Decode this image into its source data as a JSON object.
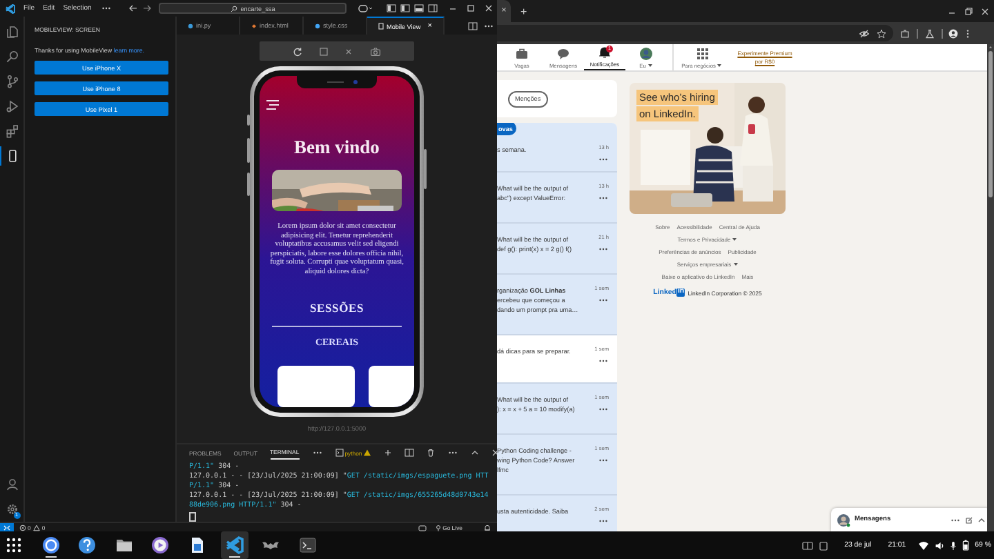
{
  "vscode": {
    "menu": [
      "File",
      "Edit",
      "Selection"
    ],
    "search": "encarte_ssa",
    "activity_bar": [
      {
        "kind": "explorer",
        "selected": false
      },
      {
        "kind": "search",
        "selected": false
      },
      {
        "kind": "source-control",
        "selected": false
      },
      {
        "kind": "run",
        "selected": false
      },
      {
        "kind": "extensions",
        "selected": false
      },
      {
        "kind": "mobile",
        "selected": true
      }
    ],
    "manage_badge": "1",
    "sidebar": {
      "title": "MOBILEVIEW: SCREEN",
      "message": "Thanks for using MobileView",
      "link": "learn more.",
      "buttons": [
        "Use iPhone X",
        "Use iPhone 8",
        "Use Pixel 1"
      ]
    },
    "tabs": [
      {
        "label": "ini.py",
        "kind": "python",
        "selected": false
      },
      {
        "label": "index.html",
        "kind": "html",
        "selected": false
      },
      {
        "label": "style.css",
        "kind": "css",
        "selected": false
      },
      {
        "label": "Mobile View",
        "kind": "preview",
        "selected": true,
        "close": "×"
      }
    ],
    "preview": {
      "page": {
        "heading": "Bem vindo",
        "paragraph": "Lorem ipsum dolor sit amet consectetur adipisicing elit. Tenetur reprehenderit voluptatibus accusamus velit sed eligendi perspiciatis, labore esse dolores officia nihil, fugit soluta. Corrupti quae voluptatum quasi, aliquid dolores dicta?",
        "section_title": "SESSÕES",
        "category": "CEREAIS"
      },
      "url": "http://127.0.0.1:5000"
    },
    "panel": {
      "tabs": [
        {
          "label": "PROBLEMS",
          "selected": false
        },
        {
          "label": "OUTPUT",
          "selected": false
        },
        {
          "label": "TERMINAL",
          "selected": true
        }
      ],
      "shell": "python",
      "lines": [
        [
          {
            "text": "P/1.1\"",
            "kind": "request"
          },
          {
            "text": " 304 -",
            "kind": "plain"
          }
        ],
        [
          {
            "text": "127.0.0.1 - - [23/Jul/2025 21:00:09] \"",
            "kind": "plain"
          },
          {
            "text": "GET /static/imgs/espaguete.png HTT",
            "kind": "request"
          }
        ],
        [
          {
            "text": "P/1.1\"",
            "kind": "request"
          },
          {
            "text": " 304 -",
            "kind": "plain"
          }
        ],
        [
          {
            "text": "127.0.0.1 - - [23/Jul/2025 21:00:09] \"",
            "kind": "plain"
          },
          {
            "text": "GET /static/imgs/655265d48d0743e14",
            "kind": "request"
          }
        ],
        [
          {
            "text": "88de906.png HTTP/1.1\"",
            "kind": "request"
          },
          {
            "text": " 304 -",
            "kind": "plain"
          }
        ]
      ]
    },
    "status_bar": {
      "errors": "0",
      "warnings": "0",
      "go_live": "Go Live"
    }
  },
  "browser": {
    "tab_close": "×",
    "new_tab": "+",
    "nav": [
      {
        "label": "Vagas",
        "kind": "jobs",
        "selected": false,
        "dropdown": false
      },
      {
        "label": "Mensagens",
        "kind": "messages",
        "selected": false,
        "dropdown": false
      },
      {
        "label": "Notificações",
        "kind": "notifications",
        "selected": true,
        "dropdown": false,
        "badge": "1"
      },
      {
        "label": "Eu",
        "kind": "me",
        "selected": false,
        "dropdown": true
      },
      {
        "label": "Para negócios",
        "kind": "business",
        "selected": false,
        "dropdown": true
      }
    ],
    "premium": "Experimente Premium por R$0",
    "filters": [
      "Menções"
    ],
    "new_button": "ovas",
    "notifications": [
      {
        "lines": [
          "s semana."
        ],
        "time": "13 h",
        "unread": true
      },
      {
        "lines": [
          "What will be the output of",
          "abc\") except ValueError:"
        ],
        "time": "13 h",
        "unread": true
      },
      {
        "lines": [
          "What will be the output of",
          "def g(): print(x) x = 2 g() f()"
        ],
        "time": "21 h",
        "unread": true
      },
      {
        "lines": [
          "rganização **GOL Linhas**",
          "ercebeu que começou a",
          "dando um prompt pra uma…"
        ],
        "time": "1 sem",
        "unread": true
      },
      {
        "lines": [
          "dá dicas para se preparar."
        ],
        "time": "1 sem",
        "unread": false
      },
      {
        "lines": [
          "What will be the output of",
          "): x = x + 5 a = 10 modify(a)"
        ],
        "time": "1 sem",
        "unread": true
      },
      {
        "lines": [
          "Python Coding challenge -",
          "wing Python Code? Answer",
          "lfmc"
        ],
        "time": "1 sem",
        "unread": true
      },
      {
        "lines": [
          "usta autenticidade. Saiba"
        ],
        "time": "2 sem",
        "unread": true
      }
    ],
    "ad": {
      "kind": "picture",
      "headline": [
        "See who’s hiring",
        "on LinkedIn."
      ]
    },
    "footer": [
      [
        {
          "text": "Sobre",
          "dropdown": false
        },
        {
          "text": "Acessibilidade",
          "dropdown": false
        },
        {
          "text": "Central de Ajuda",
          "dropdown": false
        }
      ],
      [
        {
          "text": "Termos e Privacidade",
          "dropdown": true
        }
      ],
      [
        {
          "text": "Preferências de anúncios",
          "dropdown": false
        },
        {
          "text": "Publicidade",
          "dropdown": false
        }
      ],
      [
        {
          "text": "Serviços empresariais",
          "dropdown": true
        }
      ],
      [
        {
          "text": "Baixe o aplicativo do LinkedIn",
          "dropdown": false
        },
        {
          "text": "Mais",
          "dropdown": false
        }
      ]
    ],
    "logo": [
      "Linked",
      "in"
    ],
    "copyright": "LinkedIn Corporation © 2025",
    "messaging": "Mensagens"
  },
  "taskbar": {
    "apps": [
      {
        "kind": "launcher",
        "selected": false,
        "running": false
      },
      {
        "kind": "chrome",
        "selected": false,
        "running": true
      },
      {
        "kind": "help",
        "selected": false,
        "running": false
      },
      {
        "kind": "files",
        "selected": false,
        "running": false
      },
      {
        "kind": "media",
        "selected": false,
        "running": false
      },
      {
        "kind": "docs",
        "selected": false,
        "running": false
      },
      {
        "kind": "vscode",
        "selected": true,
        "running": true
      },
      {
        "kind": "bat",
        "selected": false,
        "running": false
      },
      {
        "kind": "terminal",
        "selected": false,
        "running": false
      }
    ],
    "date": "23 de jul",
    "time": "21:01",
    "battery": "69 %"
  }
}
